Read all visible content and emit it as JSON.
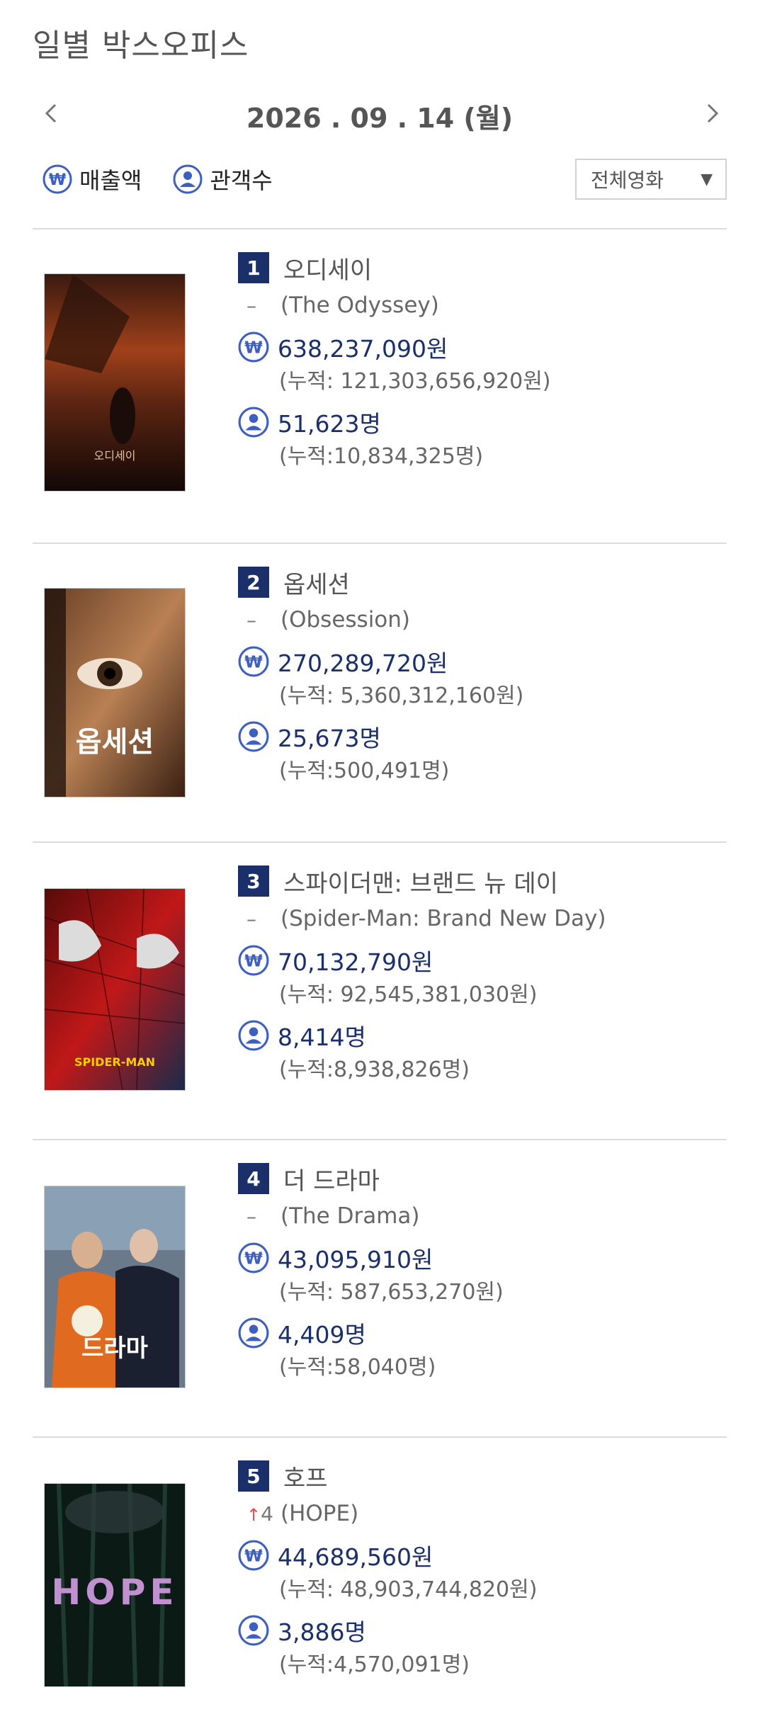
{
  "header": {
    "title": "일별 박스오피스"
  },
  "date_nav": {
    "date": "2026 . 09 . 14  (월)"
  },
  "toggles": {
    "sales_label": "매출액",
    "audience_label": "관객수"
  },
  "filter": {
    "selected": "전체영화"
  },
  "colors": {
    "accent": "#1b2f6b",
    "icon_blue": "#3d5fc0",
    "divider": "#dcdcdc"
  },
  "movies": [
    {
      "rank": "1",
      "title": "오디세이",
      "original_title": "(The Odyssey)",
      "change": "–",
      "sales": "638,237,090원",
      "sales_cum": "(누적: 121,303,656,920원)",
      "audience": "51,623명",
      "audience_cum": "(누적:10,834,325명)",
      "poster_text": "오디세이"
    },
    {
      "rank": "2",
      "title": "옵세션",
      "original_title": "(Obsession)",
      "change": "–",
      "sales": "270,289,720원",
      "sales_cum": "(누적: 5,360,312,160원)",
      "audience": "25,673명",
      "audience_cum": "(누적:500,491명)",
      "poster_text": "옵세션"
    },
    {
      "rank": "3",
      "title": "스파이더맨: 브랜드 뉴 데이",
      "original_title": "(Spider-Man: Brand New Day)",
      "change": "–",
      "sales": "70,132,790원",
      "sales_cum": "(누적: 92,545,381,030원)",
      "audience": "8,414명",
      "audience_cum": "(누적:8,938,826명)",
      "poster_text": "SPIDER-MAN"
    },
    {
      "rank": "4",
      "title": "더 드라마",
      "original_title": "(The Drama)",
      "change": "–",
      "sales": "43,095,910원",
      "sales_cum": "(누적: 587,653,270원)",
      "audience": "4,409명",
      "audience_cum": "(누적:58,040명)",
      "poster_text": "드라마"
    },
    {
      "rank": "5",
      "title": "호프",
      "original_title": "(HOPE)",
      "change": "4",
      "change_dir": "up",
      "sales": "44,689,560원",
      "sales_cum": "(누적: 48,903,744,820원)",
      "audience": "3,886명",
      "audience_cum": "(누적:4,570,091명)",
      "poster_text": "HOPE"
    }
  ]
}
